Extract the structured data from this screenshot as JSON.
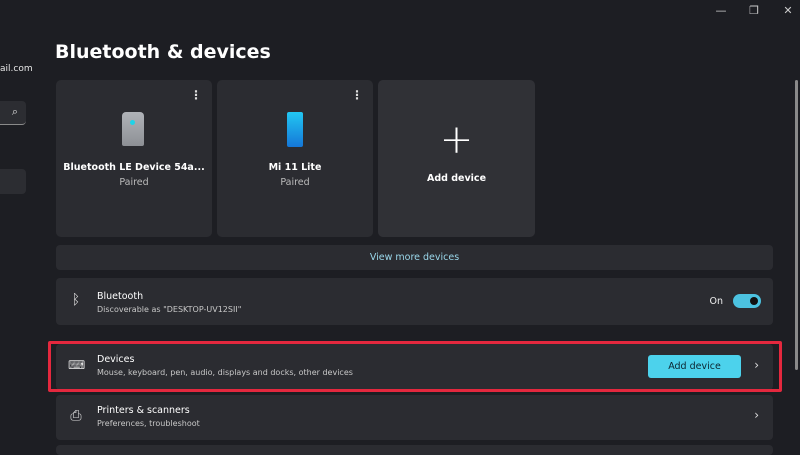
{
  "sidebar": {
    "email_fragment": "ail.com",
    "search_icon": "search-icon"
  },
  "window_controls": {
    "minimize": "—",
    "maximize": "❐",
    "close": "✕"
  },
  "page_title": "Bluetooth & devices",
  "device_cards": [
    {
      "name": "Bluetooth LE Device 54a...",
      "status": "Paired",
      "icon": "speaker-icon"
    },
    {
      "name": "Mi 11 Lite",
      "status": "Paired",
      "icon": "phone-icon"
    }
  ],
  "add_card": {
    "label": "Add device",
    "icon": "+"
  },
  "view_more": "View more devices",
  "bluetooth": {
    "title": "Bluetooth",
    "subtitle": "Discoverable as \"DESKTOP-UV12SII\"",
    "state_label": "On",
    "enabled": true
  },
  "devices": {
    "title": "Devices",
    "subtitle": "Mouse, keyboard, pen, audio, displays and docks, other devices",
    "button": "Add device"
  },
  "printers": {
    "title": "Printers & scanners",
    "subtitle": "Preferences, troubleshoot"
  },
  "colors": {
    "accent": "#4cd2ec",
    "highlight": "#e4283e"
  }
}
